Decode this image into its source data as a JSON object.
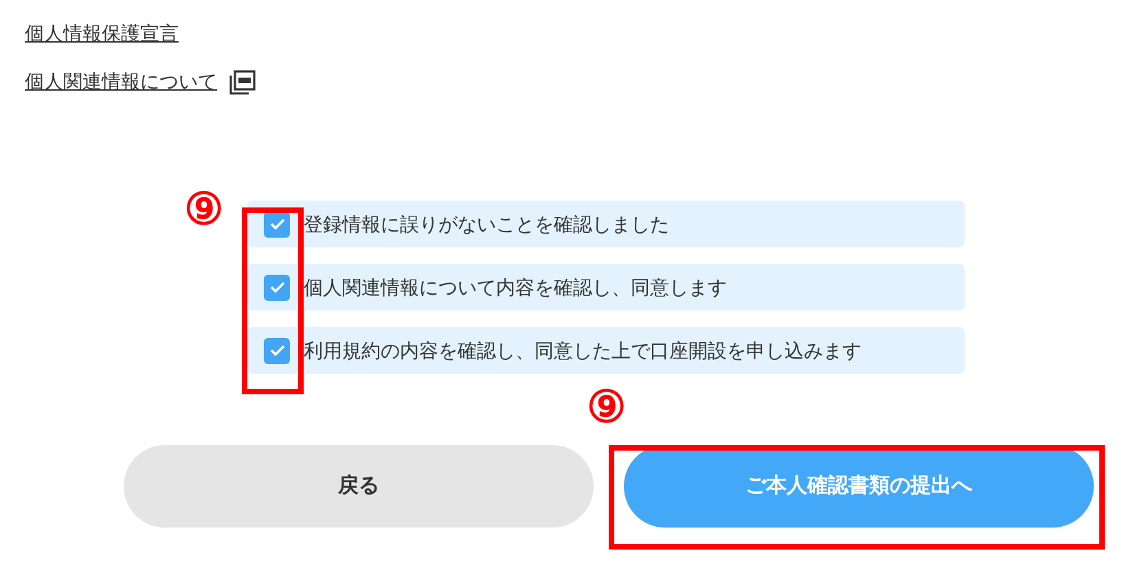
{
  "links": [
    {
      "label": "個人情報保護宣言",
      "kind": "text"
    },
    {
      "label": "個人関連情報について",
      "kind": "pdf"
    }
  ],
  "agreements": [
    {
      "label": "登録情報に誤りがないことを確認しました",
      "checked": true
    },
    {
      "label": "個人関連情報について内容を確認し、同意します",
      "checked": true
    },
    {
      "label": "利用規約の内容を確認し、同意した上で口座開設を申し込みます",
      "checked": true
    }
  ],
  "buttons": [
    {
      "label": "戻る",
      "kind": "secondary"
    },
    {
      "label": "ご本人確認書類の提出へ",
      "kind": "primary"
    }
  ],
  "annotations": {
    "checkboxes": {
      "label": "⑨"
    },
    "submit_button": {
      "label": "⑨"
    }
  }
}
